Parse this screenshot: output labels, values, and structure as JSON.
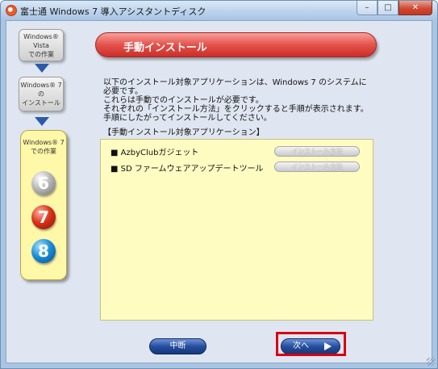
{
  "window": {
    "title": "富士通 Windows 7 導入アシスタントディスク",
    "controls": {
      "minimize": "–",
      "maximize": "□",
      "close": "✕"
    }
  },
  "steps": {
    "step1": {
      "line1": "Windows® Vista",
      "line2": "での作業"
    },
    "step2": {
      "line1": "Windows® 7 の",
      "line2": "インストール"
    },
    "step3": {
      "line1": "Windows® 7",
      "line2": "での作業"
    },
    "numbers": [
      "6",
      "7",
      "8"
    ]
  },
  "header": {
    "title": "手動インストール"
  },
  "description": {
    "line1": "以下のインストール対象アプリケーションは、Windows 7 のシステムに",
    "line2": "必要です。",
    "line3": "これらは手動でのインストールが必要です。",
    "line4": "それぞれの「インストール方法」をクリックすると手順が表示されます。",
    "line5": "手順にしたがってインストールしてください。"
  },
  "section_label": "【手動インストール対象アプリケーション】",
  "apps": [
    {
      "name": "■ AzbyClubガジェット",
      "button": "インストール方法"
    },
    {
      "name": "■ SD ファームウェアアップデートツール",
      "button": "インストール方法"
    }
  ],
  "footer": {
    "abort_label": "中断",
    "next_label": "次へ"
  },
  "colors": {
    "accent_red": "#e5524b",
    "button_blue": "#264f9f",
    "list_bg": "#fffcc2",
    "highlight": "#d8000f"
  }
}
